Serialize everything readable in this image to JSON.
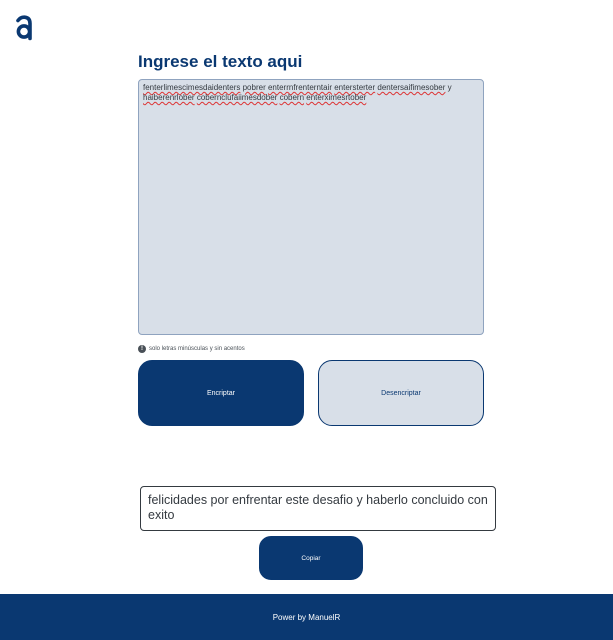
{
  "header": {
    "logo_icon": "alura-logo-icon",
    "title": "Ingrese el texto aqui"
  },
  "input": {
    "words": [
      {
        "text": "fenterlimescimesdaidenters",
        "misspelled": true
      },
      {
        "text": " ",
        "misspelled": false
      },
      {
        "text": "pobrer",
        "misspelled": true
      },
      {
        "text": " ",
        "misspelled": false
      },
      {
        "text": "enterrnfrenterntair",
        "misspelled": true
      },
      {
        "text": " ",
        "misspelled": false
      },
      {
        "text": "entersterter",
        "misspelled": true
      },
      {
        "text": " ",
        "misspelled": false
      },
      {
        "text": "dentersaifimesober",
        "misspelled": true
      },
      {
        "text": " y ",
        "misspelled": false
      },
      {
        "text": "haiberenrlober",
        "misspelled": true
      },
      {
        "text": " ",
        "misspelled": false
      },
      {
        "text": "cobernclufaiimesdober",
        "misspelled": true
      },
      {
        "text": " ",
        "misspelled": false
      },
      {
        "text": "cobern",
        "misspelled": true
      },
      {
        "text": " ",
        "misspelled": false
      },
      {
        "text": "enterximesrtober",
        "misspelled": true
      }
    ]
  },
  "hint": {
    "icon": "info-icon",
    "icon_glyph": "!",
    "text": "solo letras minúsculas y sin acentos"
  },
  "buttons": {
    "encrypt_label": "Encriptar",
    "decrypt_label": "Desencriptar",
    "copy_label": "Copiar"
  },
  "output": {
    "text": "felicidades por enfrentar este desafio y haberlo concluido con exito"
  },
  "footer": {
    "text": "Power by ManuelR"
  },
  "colors": {
    "primary": "#0a3871",
    "input_background": "#d8dfe8",
    "footer_background": "#0a3871"
  }
}
